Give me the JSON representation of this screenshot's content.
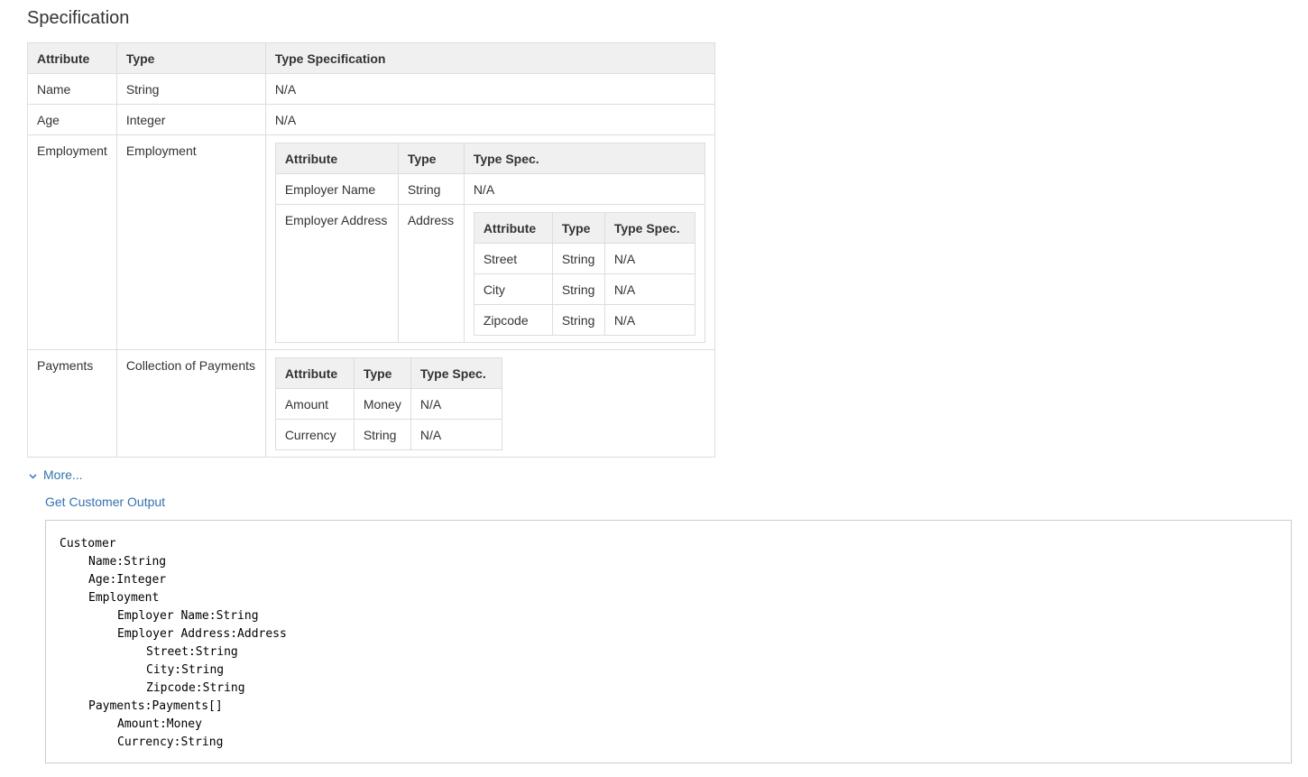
{
  "page_title": "Specification",
  "main_table": {
    "headers": [
      "Attribute",
      "Type",
      "Type Specification"
    ],
    "rows": [
      {
        "attribute": "Name",
        "type": "String",
        "spec": "N/A"
      },
      {
        "attribute": "Age",
        "type": "Integer",
        "spec": "N/A"
      },
      {
        "attribute": "Employment",
        "type": "Employment"
      },
      {
        "attribute": "Payments",
        "type": "Collection of Payments"
      }
    ]
  },
  "employment_table": {
    "headers": [
      "Attribute",
      "Type",
      "Type Spec."
    ],
    "rows": [
      {
        "attribute": "Employer Name",
        "type": "String",
        "spec": "N/A"
      },
      {
        "attribute": "Employer Address",
        "type": "Address"
      }
    ]
  },
  "address_table": {
    "headers": [
      "Attribute",
      "Type",
      "Type Spec."
    ],
    "rows": [
      {
        "attribute": "Street",
        "type": "String",
        "spec": "N/A"
      },
      {
        "attribute": "City",
        "type": "String",
        "spec": "N/A"
      },
      {
        "attribute": "Zipcode",
        "type": "String",
        "spec": "N/A"
      }
    ]
  },
  "payments_table": {
    "headers": [
      "Attribute",
      "Type",
      "Type Spec."
    ],
    "rows": [
      {
        "attribute": "Amount",
        "type": "Money",
        "spec": "N/A"
      },
      {
        "attribute": "Currency",
        "type": "String",
        "spec": "N/A"
      }
    ]
  },
  "more_link": {
    "icon": "chevron-down-icon",
    "label": "More..."
  },
  "output_link": "Get Customer Output",
  "output_code": {
    "lines": [
      "Customer",
      "Name:String",
      "Age:Integer",
      "Employment",
      "Employer Name:String",
      "Employer Address:Address",
      "Street:String",
      "City:String",
      "Zipcode:String",
      "Payments:Payments[]",
      "Amount:Money",
      "Currency:String"
    ]
  },
  "colors": {
    "link": "#3572b0",
    "header_bg": "#f0f0f0",
    "border": "#dddddd",
    "text": "#333333"
  }
}
